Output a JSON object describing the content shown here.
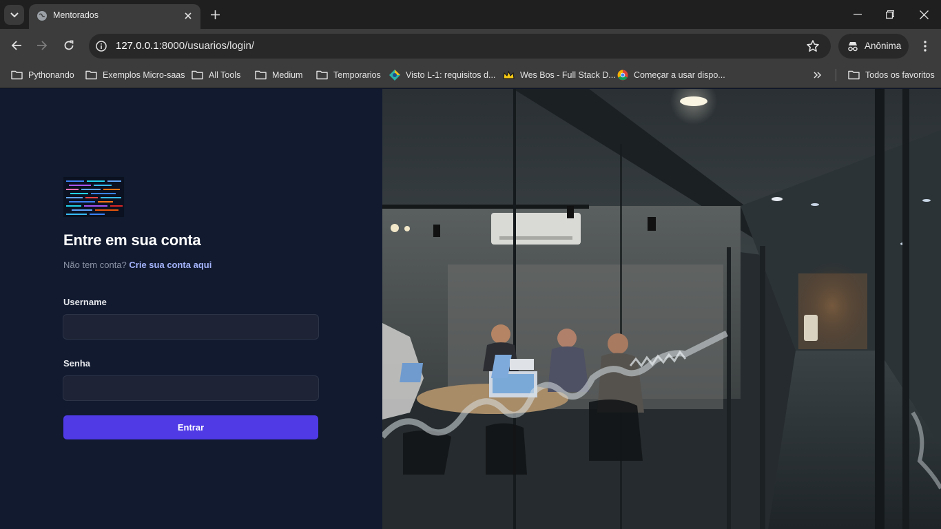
{
  "browser": {
    "tab_title": "Mentorados",
    "url_host": "127.0.0.1",
    "url_path": ":8000/usuarios/login/",
    "incognito_label": "Anônima",
    "bookmarks": [
      {
        "label": "Pythonando",
        "icon": "folder-icon"
      },
      {
        "label": "Exemplos Micro-saas",
        "icon": "folder-icon"
      },
      {
        "label": "All Tools",
        "icon": "folder-icon"
      },
      {
        "label": "Medium",
        "icon": "folder-icon"
      },
      {
        "label": "Temporarios",
        "icon": "folder-icon"
      },
      {
        "label": "Visto L-1: requisitos d...",
        "icon": "site-icon"
      },
      {
        "label": "Wes Bos - Full Stack D...",
        "icon": "crown-icon"
      },
      {
        "label": "Começar a usar dispo...",
        "icon": "chrome-icon"
      }
    ],
    "all_bookmarks_label": "Todos os favoritos"
  },
  "login": {
    "heading": "Entre em sua conta",
    "subline_prefix": "Não tem conta?",
    "subline_link": "Crie sua conta aqui",
    "username_label": "Username",
    "password_label": "Senha",
    "submit_label": "Entrar"
  },
  "colors": {
    "left_panel": "#111a2f",
    "accent": "#4f3ae6",
    "link": "#a5b4fc"
  }
}
